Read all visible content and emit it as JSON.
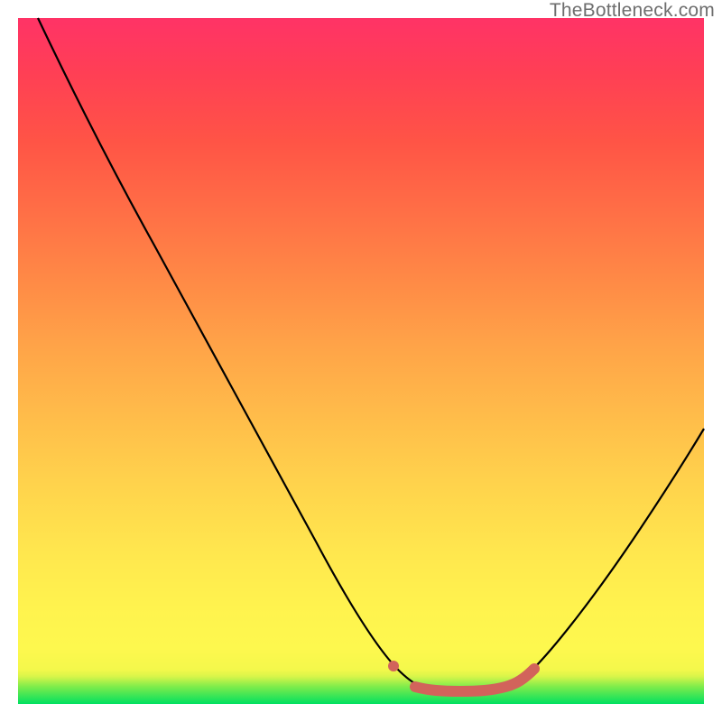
{
  "watermark": "TheBottleneck.com",
  "colors": {
    "curve_stroke": "#000000",
    "highlight_stroke": "#d2635b",
    "gradient_top": "#ff3366",
    "gradient_mid": "#ffd34c",
    "gradient_bottom": "#00e060"
  },
  "chart_data": {
    "type": "line",
    "title": "",
    "xlabel": "",
    "ylabel": "",
    "xlim": [
      0,
      100
    ],
    "ylim": [
      0,
      100
    ],
    "note": "No axis ticks or numeric labels are rendered; x/y units are normalized 0–100 estimated from pixel position.",
    "series": [
      {
        "name": "curve",
        "color": "#000000",
        "x": [
          3,
          10,
          20,
          30,
          40,
          50,
          55,
          58,
          62,
          66,
          70,
          74,
          80,
          86,
          92,
          98
        ],
        "values": [
          100,
          86,
          68,
          51,
          34,
          17,
          9.5,
          5.8,
          3.3,
          2.4,
          2.2,
          2.6,
          6.0,
          13,
          23,
          35
        ]
      },
      {
        "name": "highlight",
        "color": "#d2635b",
        "x": [
          55,
          58,
          62,
          66,
          70,
          74
        ],
        "values": [
          9.5,
          5.8,
          3.3,
          2.4,
          2.2,
          2.6
        ]
      }
    ]
  }
}
